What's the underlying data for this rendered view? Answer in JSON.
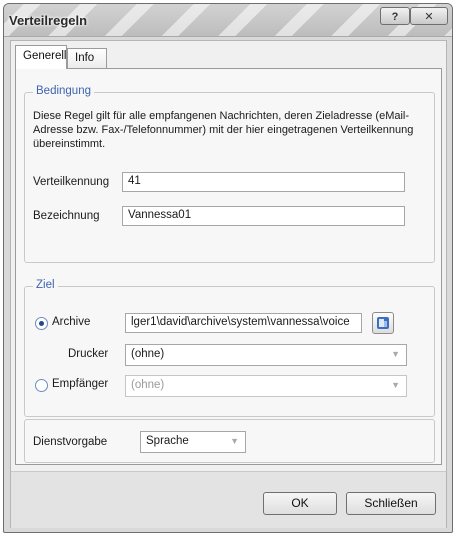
{
  "window": {
    "title": "Verteilregeln",
    "help_label": "?",
    "close_label": "✕"
  },
  "tabs": [
    {
      "label": "Generell",
      "active": true
    },
    {
      "label": "Info",
      "active": false
    }
  ],
  "bedingung": {
    "legend": "Bedingung",
    "description": "Diese Regel gilt für alle empfangenen Nachrichten, deren Zieladresse (eMail-Adresse bzw. Fax-/Telefonnummer) mit der hier eingetragenen Verteilkennung übereinstimmt.",
    "verteilkennung_label": "Verteilkennung",
    "verteilkennung_value": "41",
    "bezeichnung_label": "Bezeichnung",
    "bezeichnung_value": "Vannessa01"
  },
  "ziel": {
    "legend": "Ziel",
    "archive_label": "Archive",
    "archive_selected": true,
    "archive_path": "lger1\\david\\archive\\system\\vannessa\\voice",
    "drucker_label": "Drucker",
    "drucker_value": "(ohne)",
    "empfaenger_label": "Empfänger",
    "empfaenger_selected": false,
    "empfaenger_value": "(ohne)"
  },
  "dienstvorgabe": {
    "label": "Dienstvorgabe",
    "value": "Sprache"
  },
  "buttons": {
    "ok_label": "OK",
    "close_label": "Schließen"
  },
  "icons": {
    "browse": "folder-browse-icon",
    "dropdown": "chevron-down-icon"
  }
}
